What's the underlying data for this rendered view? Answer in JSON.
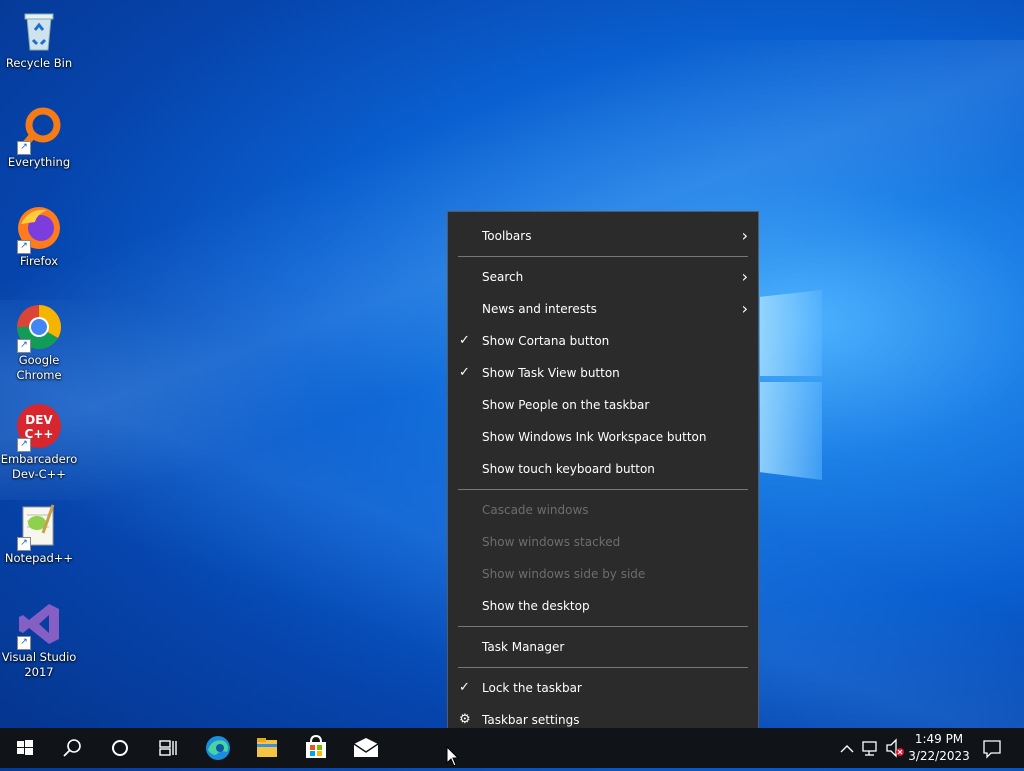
{
  "desktop": {
    "icons": [
      {
        "label": "Recycle Bin",
        "icon": "recycle-bin-icon"
      },
      {
        "label": "Everything",
        "icon": "everything-search-icon"
      },
      {
        "label": "Firefox",
        "icon": "firefox-icon"
      },
      {
        "label": "Google Chrome",
        "icon": "chrome-icon"
      },
      {
        "label": "Embarcadero Dev-C++",
        "icon": "devcpp-icon"
      },
      {
        "label": "Notepad++",
        "icon": "notepadpp-icon"
      },
      {
        "label": "Visual Studio 2017",
        "icon": "visual-studio-icon"
      }
    ]
  },
  "context_menu": {
    "items": [
      {
        "label": "Toolbars",
        "submenu": true,
        "checked": false,
        "enabled": true
      },
      {
        "label": "Search",
        "submenu": true,
        "checked": false,
        "enabled": true
      },
      {
        "label": "News and interests",
        "submenu": true,
        "checked": false,
        "enabled": true
      },
      {
        "label": "Show Cortana button",
        "submenu": false,
        "checked": true,
        "enabled": true
      },
      {
        "label": "Show Task View button",
        "submenu": false,
        "checked": true,
        "enabled": true
      },
      {
        "label": "Show People on the taskbar",
        "submenu": false,
        "checked": false,
        "enabled": true
      },
      {
        "label": "Show Windows Ink Workspace button",
        "submenu": false,
        "checked": false,
        "enabled": true
      },
      {
        "label": "Show touch keyboard button",
        "submenu": false,
        "checked": false,
        "enabled": true
      },
      {
        "label": "Cascade windows",
        "submenu": false,
        "checked": false,
        "enabled": false
      },
      {
        "label": "Show windows stacked",
        "submenu": false,
        "checked": false,
        "enabled": false
      },
      {
        "label": "Show windows side by side",
        "submenu": false,
        "checked": false,
        "enabled": false
      },
      {
        "label": "Show the desktop",
        "submenu": false,
        "checked": false,
        "enabled": true
      },
      {
        "label": "Task Manager",
        "submenu": false,
        "checked": false,
        "enabled": true
      },
      {
        "label": "Lock the taskbar",
        "submenu": false,
        "checked": true,
        "enabled": true
      },
      {
        "label": "Taskbar settings",
        "submenu": false,
        "checked": false,
        "enabled": true,
        "icon": "gear-icon"
      }
    ]
  },
  "taskbar": {
    "buttons": [
      {
        "name": "start-button",
        "icon": "windows-logo-icon"
      },
      {
        "name": "search-button",
        "icon": "search-icon"
      },
      {
        "name": "cortana-button",
        "icon": "cortana-circle-icon"
      },
      {
        "name": "task-view-button",
        "icon": "task-view-icon"
      },
      {
        "name": "edge-button",
        "icon": "edge-icon"
      },
      {
        "name": "file-explorer-button",
        "icon": "folder-icon"
      },
      {
        "name": "store-button",
        "icon": "store-icon"
      },
      {
        "name": "mail-button",
        "icon": "mail-icon"
      }
    ],
    "tray": {
      "icons": [
        "chevron-up-icon",
        "network-icon",
        "volume-muted-icon"
      ],
      "time": "1:49 PM",
      "date": "3/22/2023",
      "notification_icon": "action-center-icon"
    }
  }
}
